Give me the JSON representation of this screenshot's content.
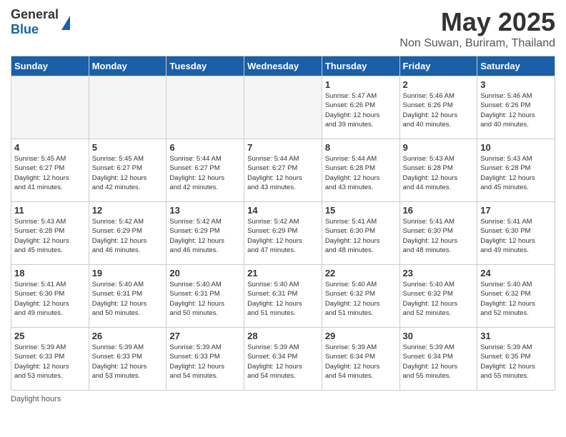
{
  "logo": {
    "general": "General",
    "blue": "Blue"
  },
  "title": "May 2025",
  "subtitle": "Non Suwan, Buriram, Thailand",
  "headers": [
    "Sunday",
    "Monday",
    "Tuesday",
    "Wednesday",
    "Thursday",
    "Friday",
    "Saturday"
  ],
  "footer_label": "Daylight hours",
  "weeks": [
    [
      {
        "num": "",
        "info": "",
        "empty": true
      },
      {
        "num": "",
        "info": "",
        "empty": true
      },
      {
        "num": "",
        "info": "",
        "empty": true
      },
      {
        "num": "",
        "info": "",
        "empty": true
      },
      {
        "num": "1",
        "info": "Sunrise: 5:47 AM\nSunset: 6:26 PM\nDaylight: 12 hours\nand 39 minutes.",
        "empty": false
      },
      {
        "num": "2",
        "info": "Sunrise: 5:46 AM\nSunset: 6:26 PM\nDaylight: 12 hours\nand 40 minutes.",
        "empty": false
      },
      {
        "num": "3",
        "info": "Sunrise: 5:46 AM\nSunset: 6:26 PM\nDaylight: 12 hours\nand 40 minutes.",
        "empty": false
      }
    ],
    [
      {
        "num": "4",
        "info": "Sunrise: 5:45 AM\nSunset: 6:27 PM\nDaylight: 12 hours\nand 41 minutes.",
        "empty": false
      },
      {
        "num": "5",
        "info": "Sunrise: 5:45 AM\nSunset: 6:27 PM\nDaylight: 12 hours\nand 42 minutes.",
        "empty": false
      },
      {
        "num": "6",
        "info": "Sunrise: 5:44 AM\nSunset: 6:27 PM\nDaylight: 12 hours\nand 42 minutes.",
        "empty": false
      },
      {
        "num": "7",
        "info": "Sunrise: 5:44 AM\nSunset: 6:27 PM\nDaylight: 12 hours\nand 43 minutes.",
        "empty": false
      },
      {
        "num": "8",
        "info": "Sunrise: 5:44 AM\nSunset: 6:28 PM\nDaylight: 12 hours\nand 43 minutes.",
        "empty": false
      },
      {
        "num": "9",
        "info": "Sunrise: 5:43 AM\nSunset: 6:28 PM\nDaylight: 12 hours\nand 44 minutes.",
        "empty": false
      },
      {
        "num": "10",
        "info": "Sunrise: 5:43 AM\nSunset: 6:28 PM\nDaylight: 12 hours\nand 45 minutes.",
        "empty": false
      }
    ],
    [
      {
        "num": "11",
        "info": "Sunrise: 5:43 AM\nSunset: 6:28 PM\nDaylight: 12 hours\nand 45 minutes.",
        "empty": false
      },
      {
        "num": "12",
        "info": "Sunrise: 5:42 AM\nSunset: 6:29 PM\nDaylight: 12 hours\nand 46 minutes.",
        "empty": false
      },
      {
        "num": "13",
        "info": "Sunrise: 5:42 AM\nSunset: 6:29 PM\nDaylight: 12 hours\nand 46 minutes.",
        "empty": false
      },
      {
        "num": "14",
        "info": "Sunrise: 5:42 AM\nSunset: 6:29 PM\nDaylight: 12 hours\nand 47 minutes.",
        "empty": false
      },
      {
        "num": "15",
        "info": "Sunrise: 5:41 AM\nSunset: 6:30 PM\nDaylight: 12 hours\nand 48 minutes.",
        "empty": false
      },
      {
        "num": "16",
        "info": "Sunrise: 5:41 AM\nSunset: 6:30 PM\nDaylight: 12 hours\nand 48 minutes.",
        "empty": false
      },
      {
        "num": "17",
        "info": "Sunrise: 5:41 AM\nSunset: 6:30 PM\nDaylight: 12 hours\nand 49 minutes.",
        "empty": false
      }
    ],
    [
      {
        "num": "18",
        "info": "Sunrise: 5:41 AM\nSunset: 6:30 PM\nDaylight: 12 hours\nand 49 minutes.",
        "empty": false
      },
      {
        "num": "19",
        "info": "Sunrise: 5:40 AM\nSunset: 6:31 PM\nDaylight: 12 hours\nand 50 minutes.",
        "empty": false
      },
      {
        "num": "20",
        "info": "Sunrise: 5:40 AM\nSunset: 6:31 PM\nDaylight: 12 hours\nand 50 minutes.",
        "empty": false
      },
      {
        "num": "21",
        "info": "Sunrise: 5:40 AM\nSunset: 6:31 PM\nDaylight: 12 hours\nand 51 minutes.",
        "empty": false
      },
      {
        "num": "22",
        "info": "Sunrise: 5:40 AM\nSunset: 6:32 PM\nDaylight: 12 hours\nand 51 minutes.",
        "empty": false
      },
      {
        "num": "23",
        "info": "Sunrise: 5:40 AM\nSunset: 6:32 PM\nDaylight: 12 hours\nand 52 minutes.",
        "empty": false
      },
      {
        "num": "24",
        "info": "Sunrise: 5:40 AM\nSunset: 6:32 PM\nDaylight: 12 hours\nand 52 minutes.",
        "empty": false
      }
    ],
    [
      {
        "num": "25",
        "info": "Sunrise: 5:39 AM\nSunset: 6:33 PM\nDaylight: 12 hours\nand 53 minutes.",
        "empty": false
      },
      {
        "num": "26",
        "info": "Sunrise: 5:39 AM\nSunset: 6:33 PM\nDaylight: 12 hours\nand 53 minutes.",
        "empty": false
      },
      {
        "num": "27",
        "info": "Sunrise: 5:39 AM\nSunset: 6:33 PM\nDaylight: 12 hours\nand 54 minutes.",
        "empty": false
      },
      {
        "num": "28",
        "info": "Sunrise: 5:39 AM\nSunset: 6:34 PM\nDaylight: 12 hours\nand 54 minutes.",
        "empty": false
      },
      {
        "num": "29",
        "info": "Sunrise: 5:39 AM\nSunset: 6:34 PM\nDaylight: 12 hours\nand 54 minutes.",
        "empty": false
      },
      {
        "num": "30",
        "info": "Sunrise: 5:39 AM\nSunset: 6:34 PM\nDaylight: 12 hours\nand 55 minutes.",
        "empty": false
      },
      {
        "num": "31",
        "info": "Sunrise: 5:39 AM\nSunset: 6:35 PM\nDaylight: 12 hours\nand 55 minutes.",
        "empty": false
      }
    ]
  ]
}
